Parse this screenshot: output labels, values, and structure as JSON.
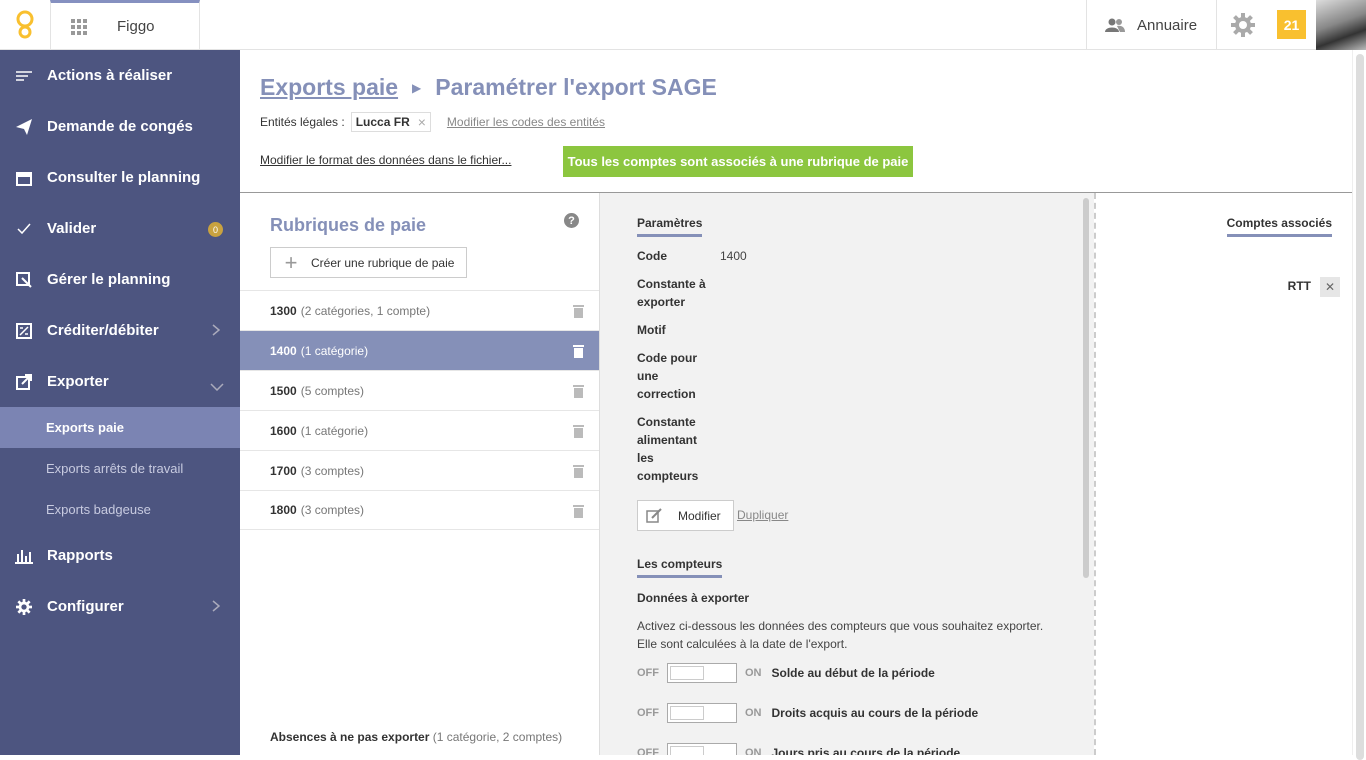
{
  "topbar": {
    "app_name": "Figgo",
    "directory_label": "Annuaire",
    "notifications_count": "21"
  },
  "sidebar": {
    "items": [
      {
        "label": "Actions à réaliser",
        "icon": "list-icon"
      },
      {
        "label": "Demande de congés",
        "icon": "send-icon"
      },
      {
        "label": "Consulter le planning",
        "icon": "calendar-icon"
      },
      {
        "label": "Valider",
        "icon": "check-icon",
        "badge": "0"
      },
      {
        "label": "Gérer le planning",
        "icon": "edit-planning-icon"
      },
      {
        "label": "Créditer/débiter",
        "icon": "ledger-icon"
      },
      {
        "label": "Exporter",
        "icon": "export-icon"
      }
    ],
    "subitems": [
      {
        "label": "Exports paie"
      },
      {
        "label": "Exports arrêts de travail"
      },
      {
        "label": "Exports badgeuse"
      }
    ],
    "bottom_items": [
      {
        "label": "Rapports",
        "icon": "chart-icon"
      },
      {
        "label": "Configurer",
        "icon": "gear-icon"
      }
    ]
  },
  "header": {
    "breadcrumb_link": "Exports paie",
    "breadcrumb_current": "Paramétrer l'export SAGE",
    "entities_label": "Entités légales :",
    "entity_tag": "Lucca FR",
    "modify_codes_link": "Modifier les codes des entités",
    "modify_format_link": "Modifier le format des données dans le fichier...",
    "status_banner": "Tous les comptes sont associés à une rubrique de paie"
  },
  "rubriques": {
    "title": "Rubriques de paie",
    "create_button": "Créer une rubrique de paie",
    "items": [
      {
        "code": "1300",
        "info": "(2 catégories, 1 compte)"
      },
      {
        "code": "1400",
        "info": "(1 catégorie)"
      },
      {
        "code": "1500",
        "info": "(5 comptes)"
      },
      {
        "code": "1600",
        "info": "(1 catégorie)"
      },
      {
        "code": "1700",
        "info": "(3 comptes)"
      },
      {
        "code": "1800",
        "info": "(3 comptes)"
      }
    ],
    "footer_label": "Absences à ne pas exporter",
    "footer_info": "(1 catégorie, 2 comptes)"
  },
  "params": {
    "title": "Paramètres",
    "code_label": "Code",
    "code_value": "1400",
    "const_label": "Constante à exporter",
    "motif_label": "Motif",
    "correction_label": "Code pour une correction",
    "counter_const_label": "Constante alimentant les compteurs",
    "modify_button": "Modifier",
    "duplicate_link": "Dupliquer",
    "counters_title": "Les compteurs",
    "export_data_label": "Données à exporter",
    "description": "Activez ci-dessous les données des compteurs que vous souhaitez exporter. Elle sont calculées à la date de l'export.",
    "off_label": "OFF",
    "on_label": "ON",
    "toggles": [
      {
        "label": "Solde au début de la période"
      },
      {
        "label": "Droits acquis au cours de la période"
      },
      {
        "label": "Jours pris au cours de la période"
      }
    ]
  },
  "comptes": {
    "title": "Comptes associés",
    "items": [
      {
        "label": "RTT"
      }
    ]
  },
  "colors": {
    "sidebar_bg": "#4d5580",
    "accent": "#8590b8",
    "success": "#8cc63f",
    "notif": "#f9c02f"
  }
}
